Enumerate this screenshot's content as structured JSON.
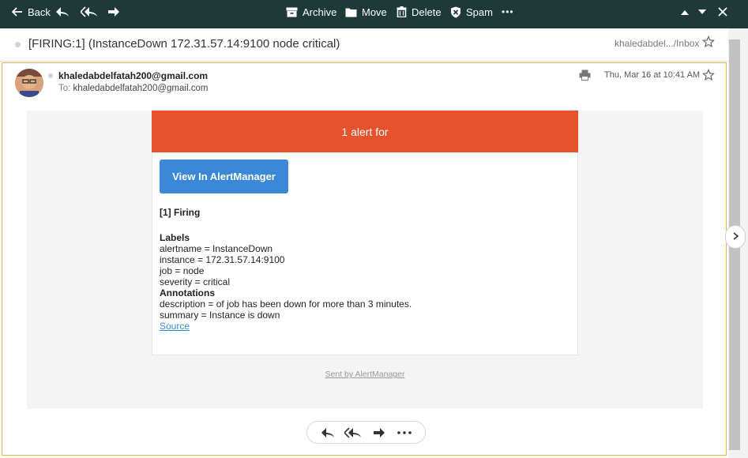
{
  "toolbar": {
    "back_label": "Back",
    "archive_label": "Archive",
    "move_label": "Move",
    "delete_label": "Delete",
    "spam_label": "Spam",
    "more_label": "•••"
  },
  "message": {
    "subject": "[FIRING:1] (InstanceDown 172.31.57.14:9100 node critical)",
    "folder": "khaledabdel.../Inbox",
    "sender": "khaledabdelfatah200@gmail.com",
    "to_label": "To:",
    "to_address": "khaledabdelfatah200@gmail.com",
    "date": "Thu, Mar 16 at 10:41 AM"
  },
  "alert_email": {
    "header_text": "1 alert for",
    "button_label": "View In AlertManager",
    "firing_title": "[1] Firing",
    "labels_title": "Labels",
    "labels": [
      "alertname = InstanceDown",
      "instance = 172.31.57.14:9100",
      "job = node",
      "severity = critical"
    ],
    "annotations_title": "Annotations",
    "annotations": [
      "description = of job has been down for more than 3 minutes.",
      "summary = Instance is down"
    ],
    "source_link": "Source",
    "footer": "Sent by AlertManager"
  },
  "colors": {
    "toolbar_bg": "#1e3a36",
    "alert_header": "#e6522c",
    "button_blue": "#3b88d6",
    "selected_border": "#e7b84c"
  },
  "icons": [
    "back-arrow-icon",
    "reply-icon",
    "reply-all-icon",
    "forward-icon",
    "archive-icon",
    "move-icon",
    "trash-icon",
    "shield-icon",
    "more-icon",
    "chevron-up-icon",
    "chevron-down-icon",
    "close-icon",
    "star-icon",
    "print-icon",
    "chevron-right-icon"
  ]
}
